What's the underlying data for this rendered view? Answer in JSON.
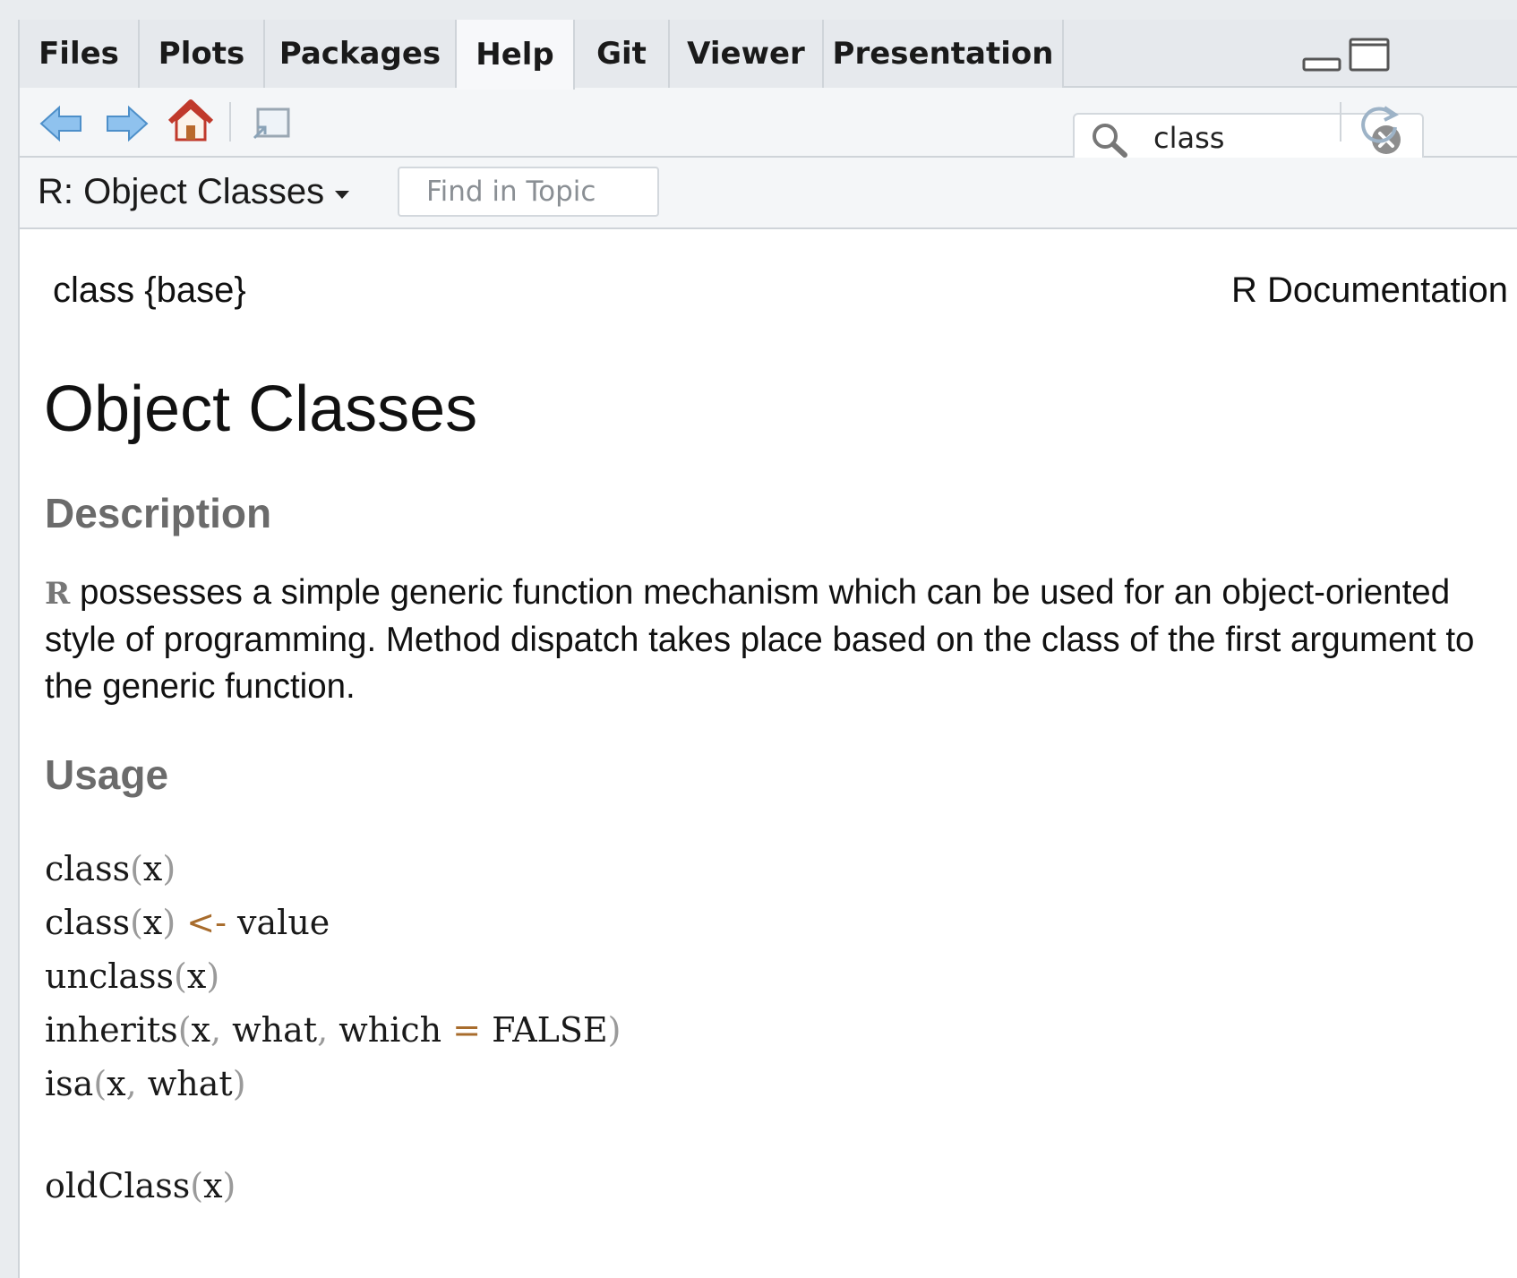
{
  "tabs": [
    "Files",
    "Plots",
    "Packages",
    "Help",
    "Git",
    "Viewer",
    "Presentation"
  ],
  "active_tab": "Help",
  "search": {
    "value": "class"
  },
  "topic": {
    "title": "R: Object Classes",
    "find_placeholder": "Find in Topic"
  },
  "doc": {
    "package": "class {base}",
    "source": "R Documentation",
    "title": "Object Classes",
    "description_heading": "Description",
    "description_r": "R",
    "description_text": "possesses a simple generic function mechanism which can be used for an object-oriented style of programming. Method dispatch takes place based on the class of the first argument to the generic function.",
    "usage_heading": "Usage",
    "usage": [
      "class(x)",
      "class(x) <- value",
      "unclass(x)",
      "inherits(x, what, which = FALSE)",
      "isa(x, what)",
      "",
      "oldClass(x)"
    ]
  },
  "colors": {
    "heading_gray": "#6b6b6b",
    "assign_operator": "#a86c2c",
    "logical_constant": "#9b2a6a",
    "home_icon": "#c0392b",
    "nav_arrow": "#5aa0dc"
  },
  "icons": [
    "back-arrow-icon",
    "forward-arrow-icon",
    "home-icon",
    "show-in-window-icon",
    "search-icon",
    "clear-icon",
    "refresh-icon",
    "minimize-icon",
    "maximize-icon"
  ]
}
